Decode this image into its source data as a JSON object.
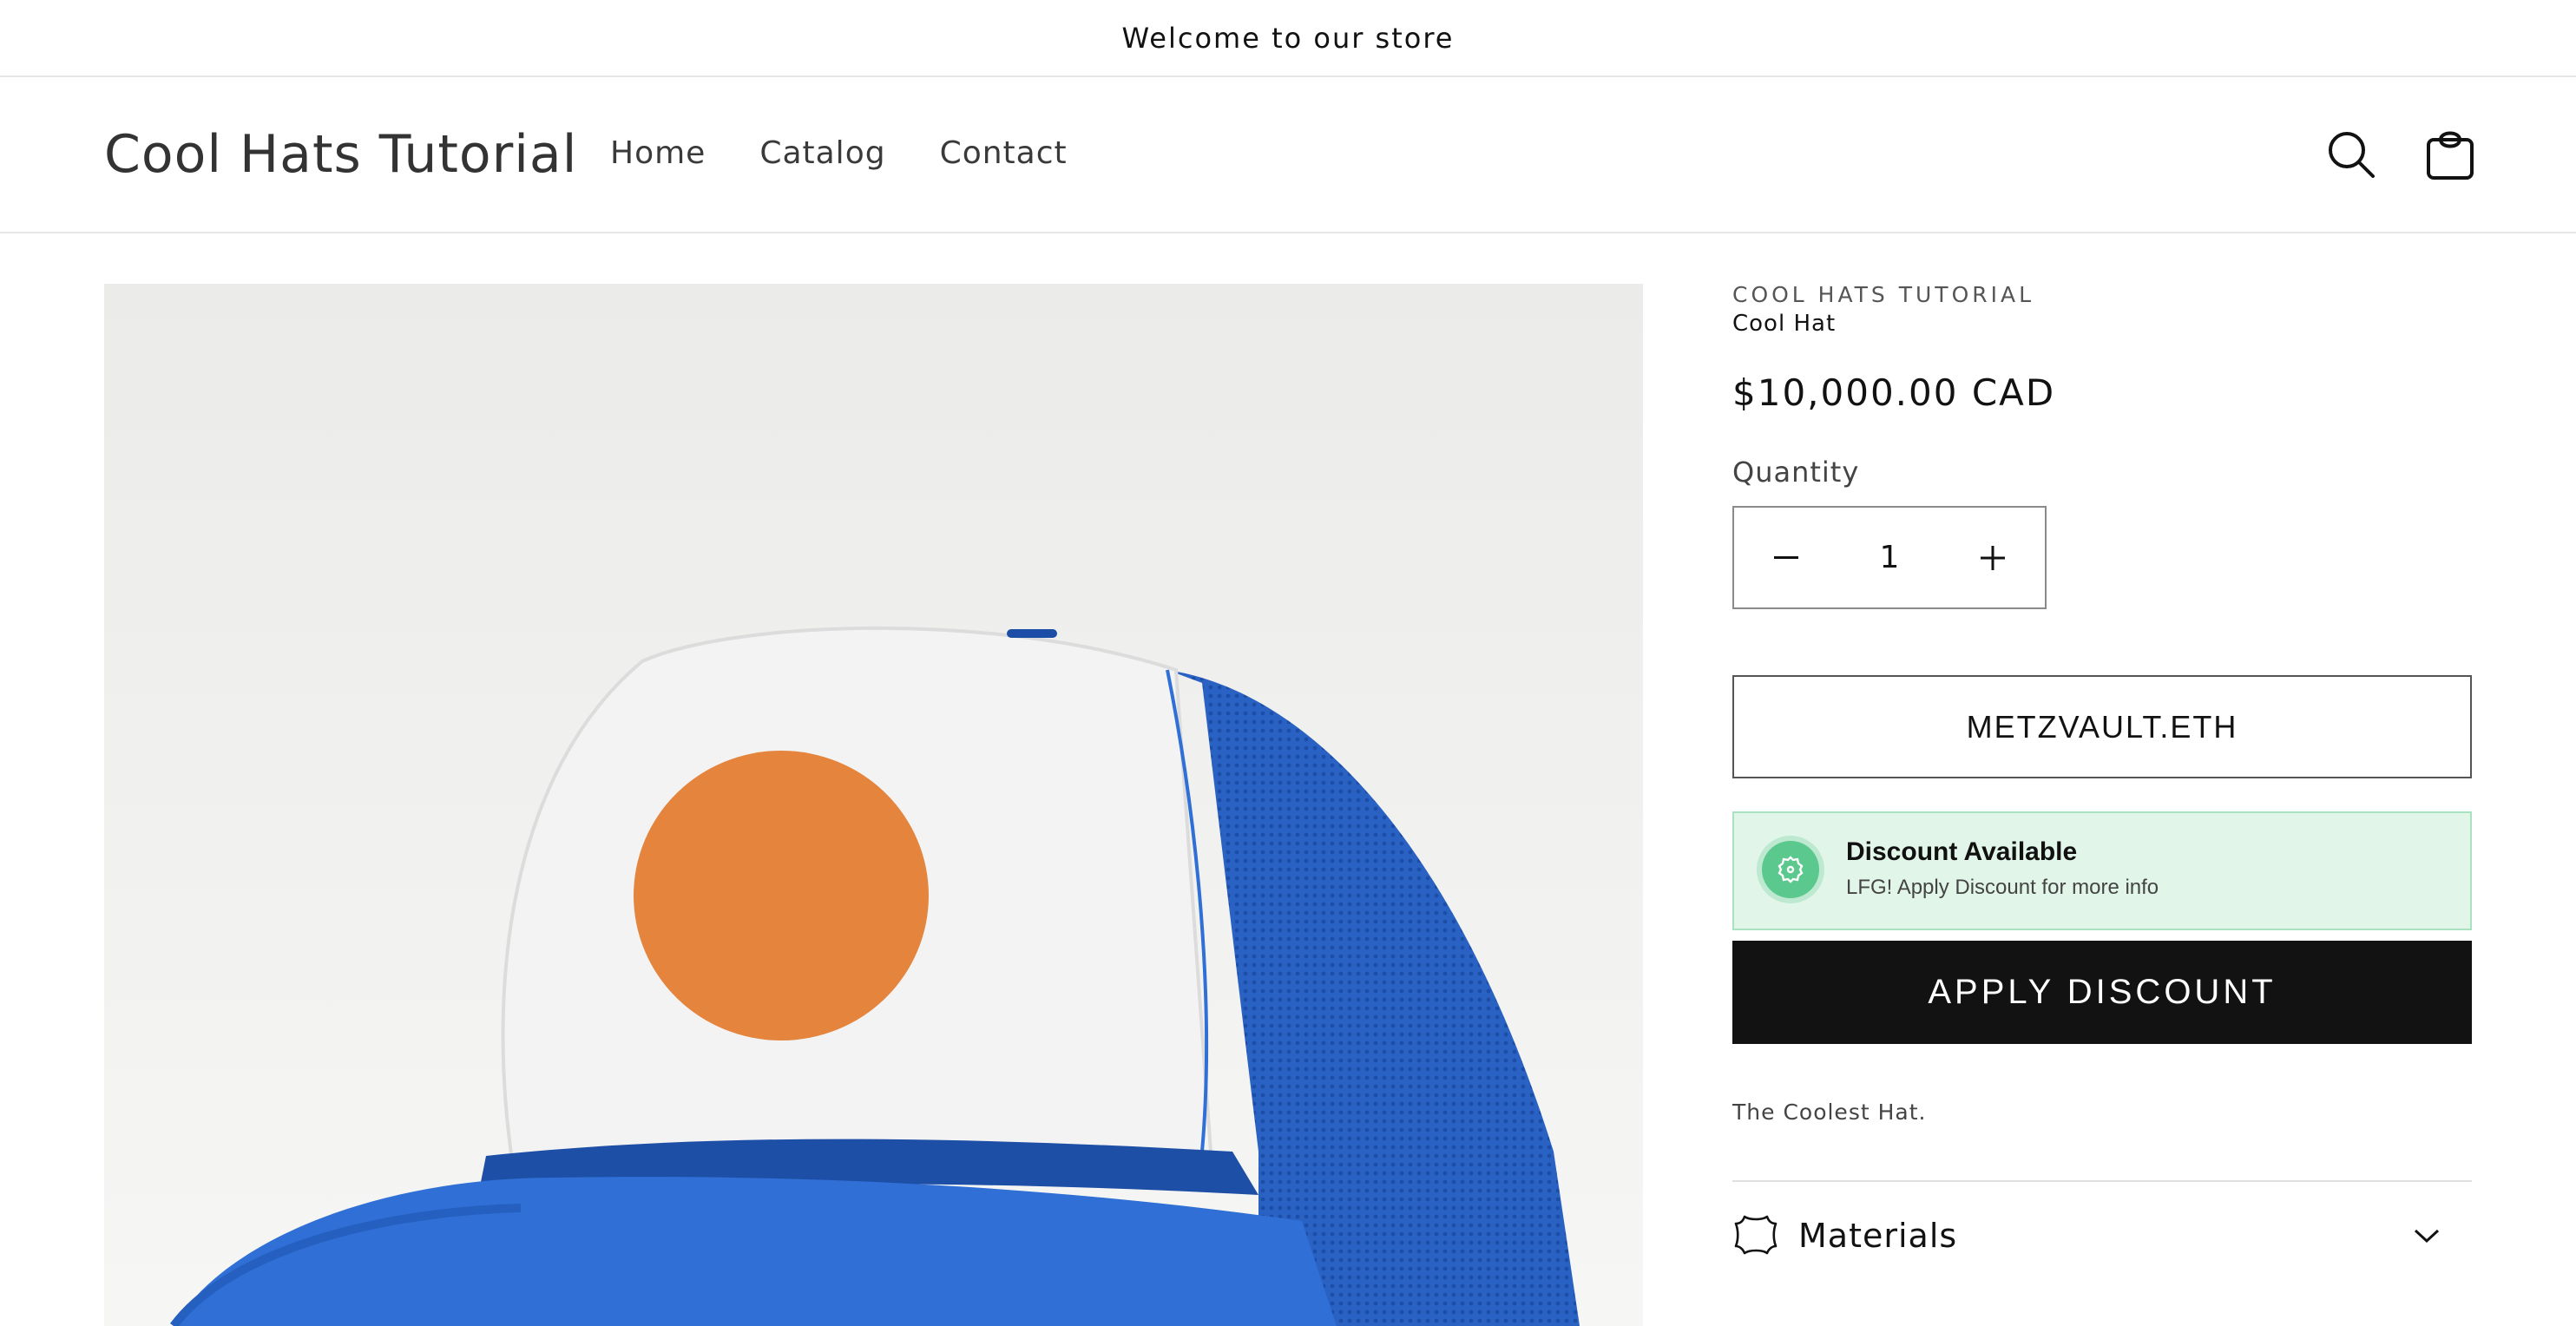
{
  "announcement": {
    "text": "Welcome to our store"
  },
  "header": {
    "logo": "Cool Hats Tutorial",
    "nav": [
      {
        "label": "Home"
      },
      {
        "label": "Catalog"
      },
      {
        "label": "Contact"
      }
    ],
    "icons": {
      "search": "search-icon",
      "cart": "cart-icon"
    }
  },
  "product": {
    "vendor": "COOL HATS TUTORIAL",
    "title": "Cool Hat",
    "price": "$10,000.00 CAD",
    "quantity_label": "Quantity",
    "quantity": "1",
    "wallet_label": "METZVAULT.ETH",
    "discount": {
      "title": "Discount Available",
      "subtitle": "LFG! Apply Discount for more info",
      "color": "#e1f5e9"
    },
    "apply_label": "APPLY DISCOUNT",
    "description": "The Coolest Hat.",
    "accordion": {
      "label": "Materials",
      "icon": "leather-icon"
    }
  },
  "colors": {
    "accent_dark": "#121212",
    "hat_blue": "#2f6fd6",
    "hat_dot": "#e4843d",
    "discount_green": "#5bc88e"
  }
}
